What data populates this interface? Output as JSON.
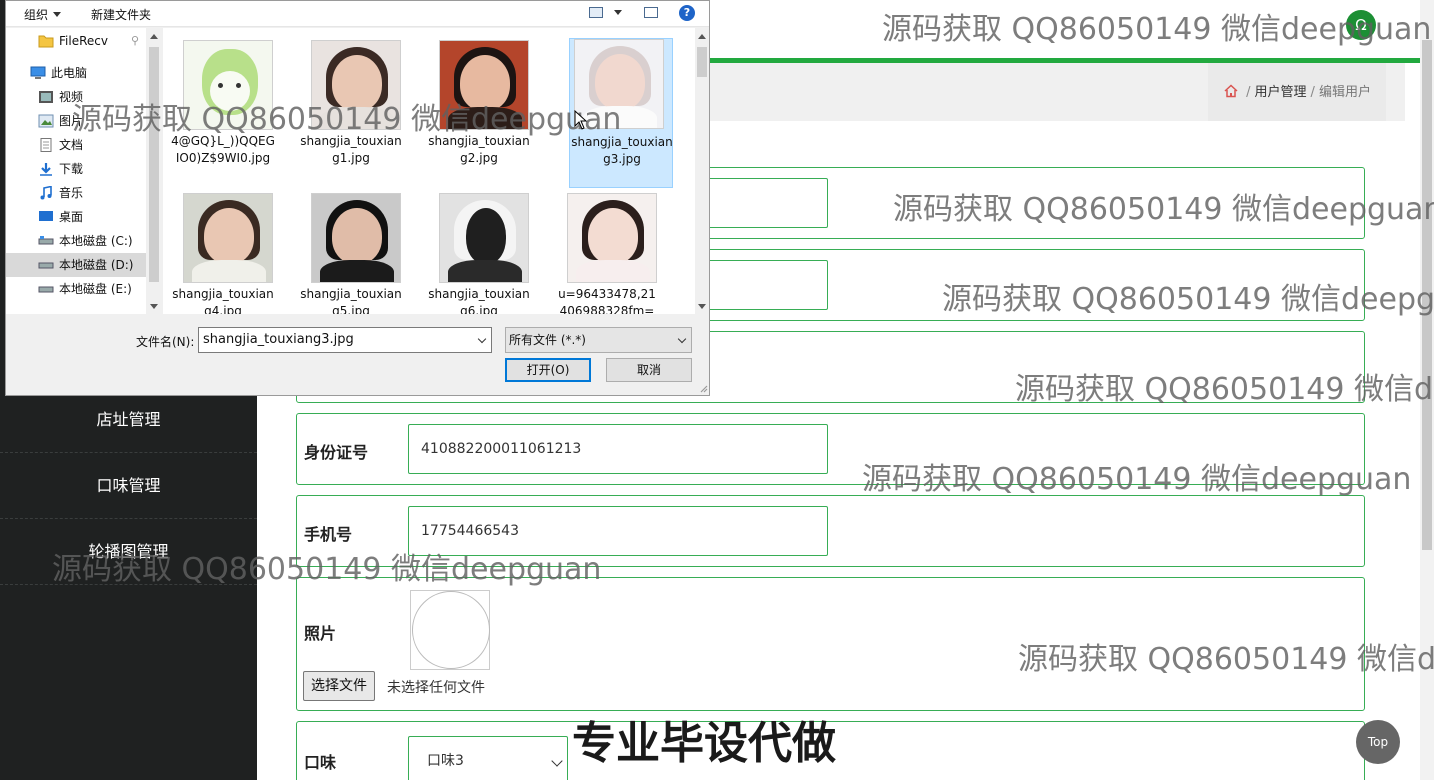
{
  "sidebar": {
    "items": [
      {
        "label": "店址管理"
      },
      {
        "label": "口味管理"
      },
      {
        "label": "轮播图管理"
      }
    ]
  },
  "breadcrumb": {
    "home_icon": "home-icon",
    "section": "用户管理",
    "current": "编辑用户",
    "separator": "/"
  },
  "header": {
    "avatar_glyph": "Ω"
  },
  "form": {
    "id_label": "身份证号",
    "id_value": "410882200011061213",
    "phone_label": "手机号",
    "phone_value": "17754466543",
    "photo_label": "照片",
    "choose_file_label": "选择文件",
    "no_file_text": "未选择任何文件",
    "flavor_label": "口味",
    "flavor_value": "口味3"
  },
  "overlay_text": {
    "banner": "专业毕设代做",
    "watermarks": [
      "源码获取 QQ86050149 微信deepguan",
      "源码获取 QQ86050149 微信deepguan",
      "源码获取 QQ86050149 微信deepguan",
      "源码获取 QQ86050149 微信deepgu",
      "源码获取 QQ86050149 微信de",
      "源码获取 QQ86050149 微信deepguan",
      "源码获取 QQ86050149 微信deepguan",
      "源码获取 QQ86050149 微信de"
    ]
  },
  "top_button": "Top",
  "dialog": {
    "toolbar": {
      "organize": "组织",
      "new_folder": "新建文件夹",
      "help": "?"
    },
    "nav": [
      {
        "label": "FileRecv",
        "icon": "folder-icon"
      },
      {
        "label": "此电脑",
        "icon": "computer-icon"
      },
      {
        "label": "视频",
        "icon": "video-icon"
      },
      {
        "label": "图片",
        "icon": "picture-icon"
      },
      {
        "label": "文档",
        "icon": "document-icon"
      },
      {
        "label": "下载",
        "icon": "download-icon"
      },
      {
        "label": "音乐",
        "icon": "music-icon"
      },
      {
        "label": "桌面",
        "icon": "desktop-icon"
      },
      {
        "label": "本地磁盘 (C:)",
        "icon": "drive-icon"
      },
      {
        "label": "本地磁盘 (D:)",
        "icon": "drive-icon"
      },
      {
        "label": "本地磁盘 (E:)",
        "icon": "drive-icon"
      }
    ],
    "files": [
      {
        "name": "4@GQ}L_))QQEGIO0)Z$9WI0.jpg"
      },
      {
        "name": "shangjia_touxiang1.jpg"
      },
      {
        "name": "shangjia_touxiang2.jpg"
      },
      {
        "name": "shangjia_touxiang3.jpg"
      },
      {
        "name": "shangjia_touxiang4.jpg"
      },
      {
        "name": "shangjia_touxiang5.jpg"
      },
      {
        "name": "shangjia_touxiang6.jpg"
      },
      {
        "name": "u=96433478,21406988328fm="
      }
    ],
    "filename_label": "文件名(N):",
    "filename_value": "shangjia_touxiang3.jpg",
    "filetype_value": "所有文件 (*.*)",
    "open_label": "打开(O)",
    "cancel_label": "取消"
  }
}
